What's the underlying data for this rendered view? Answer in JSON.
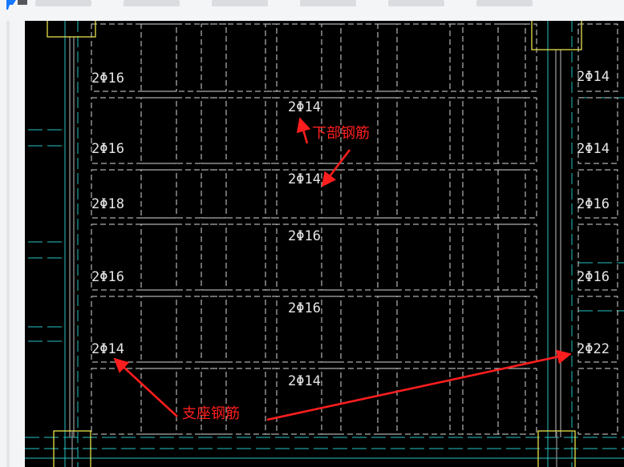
{
  "app": {
    "title": "",
    "toolbar_items": [
      "",
      "",
      "",
      "",
      "",
      ""
    ]
  },
  "drawing": {
    "colors": {
      "background": "#000000",
      "grid_dash": "#d8d8d8",
      "beam": "#8a8a8a",
      "axis": "#25c3c3",
      "column": "#e8e24a",
      "label_text": "#e6e6e6",
      "annotation": "#ff1e1e"
    },
    "rebar_labels": {
      "left_column": [
        "2Φ16",
        "2Φ16",
        "2Φ18",
        "2Φ16",
        "2Φ14"
      ],
      "middle_column": [
        "2Φ14",
        "2Φ14",
        "2Φ16",
        "2Φ16",
        "2Φ14"
      ],
      "right_column": [
        "2Φ14",
        "2Φ14",
        "2Φ16",
        "2Φ16",
        "2Φ22"
      ]
    },
    "annotations": {
      "bottom_rebar": "下部钢筋",
      "support_rebar": "支座钢筋"
    }
  }
}
